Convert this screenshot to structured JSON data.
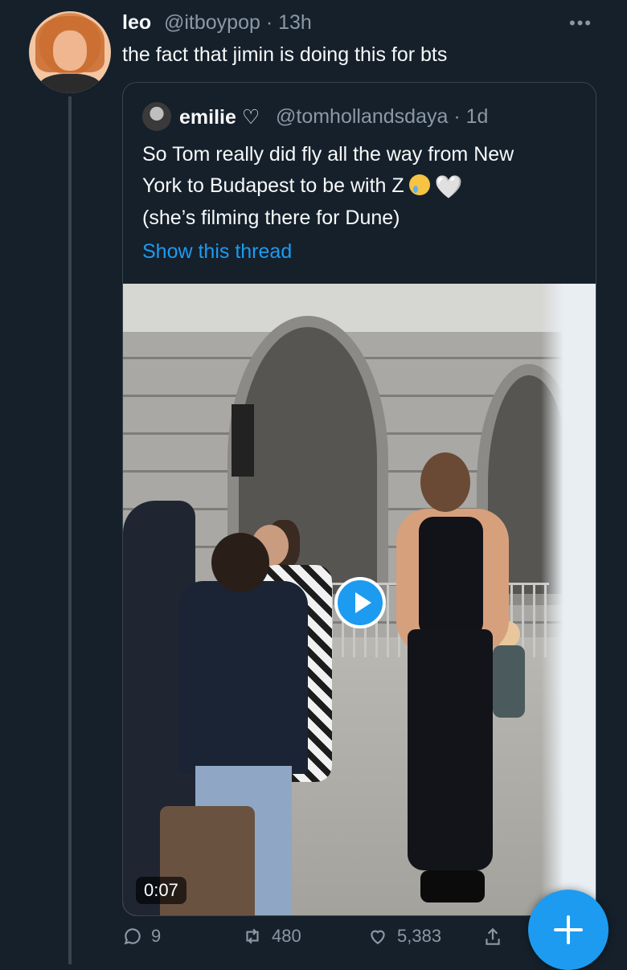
{
  "tweet": {
    "author_name": "leo",
    "author_handle": "@itboypop · 13h",
    "text": "the fact that jimin is doing this for bts",
    "more_icon": "more-horizontal-icon"
  },
  "quote": {
    "author_name": "emilie ♡",
    "author_handle": "@tomhollandsdaya · 1d",
    "text_line1": "So Tom really did fly all the way from New",
    "text_line2": "York to Budapest to be with Z",
    "text_line3": "(she’s filming there for Dune)",
    "emoji1": "crying-face-emoji",
    "emoji2": "🤍",
    "show_thread": "Show this thread",
    "video_duration": "0:07"
  },
  "actions": {
    "replies": "9",
    "retweets": "480",
    "likes": "5,383"
  },
  "colors": {
    "background": "#15202b",
    "accent": "#1d9bf0",
    "muted_text": "#8b98a5",
    "border": "#38444d"
  }
}
